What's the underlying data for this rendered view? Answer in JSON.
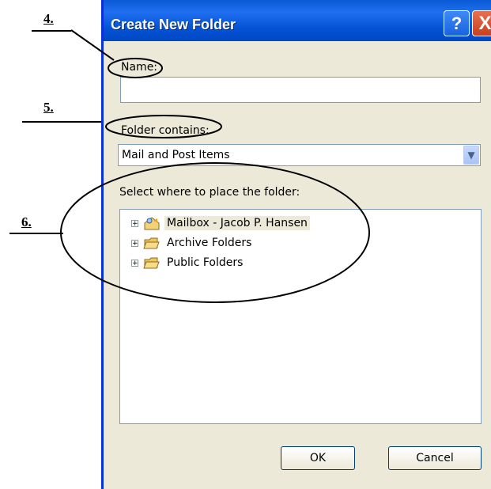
{
  "annotations": {
    "n4": "4.",
    "n5": "5.",
    "n6": "6."
  },
  "window": {
    "title": "Create New Folder",
    "help": "?",
    "close": "X"
  },
  "form": {
    "name_label": "Name:",
    "name_value": "",
    "contains_label": "Folder contains:",
    "contains_value": "Mail and Post Items",
    "place_label": "Select where to place the folder:"
  },
  "tree": [
    {
      "label": "Mailbox - Jacob P. Hansen",
      "icon": "mailbox-icon",
      "expander": "+"
    },
    {
      "label": "Archive Folders",
      "icon": "folder-icon",
      "expander": "+"
    },
    {
      "label": "Public Folders",
      "icon": "folder-icon",
      "expander": "+"
    }
  ],
  "buttons": {
    "ok": "OK",
    "cancel": "Cancel"
  },
  "colors": {
    "titlebar": "#0a5ad6",
    "dialog_bg": "#ece9d8",
    "border": "#7f9db9",
    "close": "#c6401e"
  }
}
